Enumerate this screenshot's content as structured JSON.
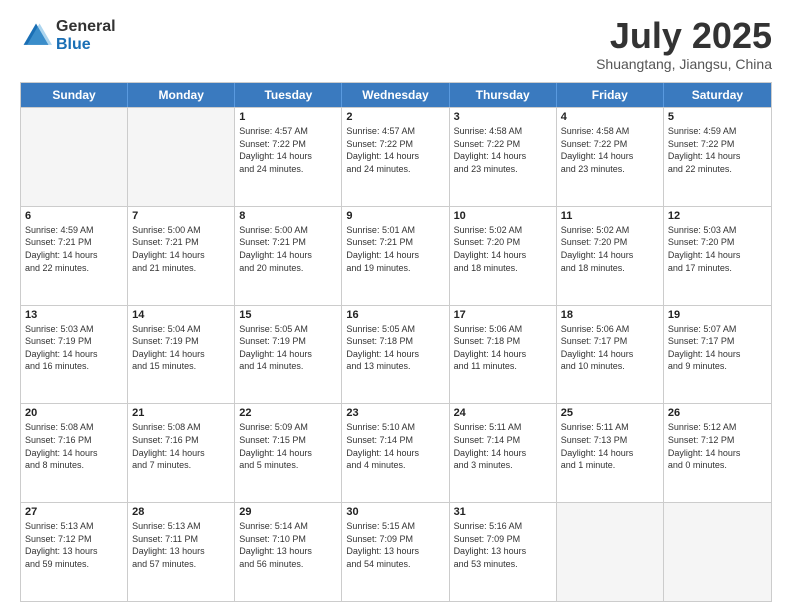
{
  "logo": {
    "general": "General",
    "blue": "Blue"
  },
  "title": "July 2025",
  "subtitle": "Shuangtang, Jiangsu, China",
  "days_of_week": [
    "Sunday",
    "Monday",
    "Tuesday",
    "Wednesday",
    "Thursday",
    "Friday",
    "Saturday"
  ],
  "weeks": [
    [
      {
        "day": "",
        "empty": true
      },
      {
        "day": "",
        "empty": true
      },
      {
        "day": "1",
        "lines": [
          "Sunrise: 4:57 AM",
          "Sunset: 7:22 PM",
          "Daylight: 14 hours",
          "and 24 minutes."
        ]
      },
      {
        "day": "2",
        "lines": [
          "Sunrise: 4:57 AM",
          "Sunset: 7:22 PM",
          "Daylight: 14 hours",
          "and 24 minutes."
        ]
      },
      {
        "day": "3",
        "lines": [
          "Sunrise: 4:58 AM",
          "Sunset: 7:22 PM",
          "Daylight: 14 hours",
          "and 23 minutes."
        ]
      },
      {
        "day": "4",
        "lines": [
          "Sunrise: 4:58 AM",
          "Sunset: 7:22 PM",
          "Daylight: 14 hours",
          "and 23 minutes."
        ]
      },
      {
        "day": "5",
        "lines": [
          "Sunrise: 4:59 AM",
          "Sunset: 7:22 PM",
          "Daylight: 14 hours",
          "and 22 minutes."
        ]
      }
    ],
    [
      {
        "day": "6",
        "lines": [
          "Sunrise: 4:59 AM",
          "Sunset: 7:21 PM",
          "Daylight: 14 hours",
          "and 22 minutes."
        ]
      },
      {
        "day": "7",
        "lines": [
          "Sunrise: 5:00 AM",
          "Sunset: 7:21 PM",
          "Daylight: 14 hours",
          "and 21 minutes."
        ]
      },
      {
        "day": "8",
        "lines": [
          "Sunrise: 5:00 AM",
          "Sunset: 7:21 PM",
          "Daylight: 14 hours",
          "and 20 minutes."
        ]
      },
      {
        "day": "9",
        "lines": [
          "Sunrise: 5:01 AM",
          "Sunset: 7:21 PM",
          "Daylight: 14 hours",
          "and 19 minutes."
        ]
      },
      {
        "day": "10",
        "lines": [
          "Sunrise: 5:02 AM",
          "Sunset: 7:20 PM",
          "Daylight: 14 hours",
          "and 18 minutes."
        ]
      },
      {
        "day": "11",
        "lines": [
          "Sunrise: 5:02 AM",
          "Sunset: 7:20 PM",
          "Daylight: 14 hours",
          "and 18 minutes."
        ]
      },
      {
        "day": "12",
        "lines": [
          "Sunrise: 5:03 AM",
          "Sunset: 7:20 PM",
          "Daylight: 14 hours",
          "and 17 minutes."
        ]
      }
    ],
    [
      {
        "day": "13",
        "lines": [
          "Sunrise: 5:03 AM",
          "Sunset: 7:19 PM",
          "Daylight: 14 hours",
          "and 16 minutes."
        ]
      },
      {
        "day": "14",
        "lines": [
          "Sunrise: 5:04 AM",
          "Sunset: 7:19 PM",
          "Daylight: 14 hours",
          "and 15 minutes."
        ]
      },
      {
        "day": "15",
        "lines": [
          "Sunrise: 5:05 AM",
          "Sunset: 7:19 PM",
          "Daylight: 14 hours",
          "and 14 minutes."
        ]
      },
      {
        "day": "16",
        "lines": [
          "Sunrise: 5:05 AM",
          "Sunset: 7:18 PM",
          "Daylight: 14 hours",
          "and 13 minutes."
        ]
      },
      {
        "day": "17",
        "lines": [
          "Sunrise: 5:06 AM",
          "Sunset: 7:18 PM",
          "Daylight: 14 hours",
          "and 11 minutes."
        ]
      },
      {
        "day": "18",
        "lines": [
          "Sunrise: 5:06 AM",
          "Sunset: 7:17 PM",
          "Daylight: 14 hours",
          "and 10 minutes."
        ]
      },
      {
        "day": "19",
        "lines": [
          "Sunrise: 5:07 AM",
          "Sunset: 7:17 PM",
          "Daylight: 14 hours",
          "and 9 minutes."
        ]
      }
    ],
    [
      {
        "day": "20",
        "lines": [
          "Sunrise: 5:08 AM",
          "Sunset: 7:16 PM",
          "Daylight: 14 hours",
          "and 8 minutes."
        ]
      },
      {
        "day": "21",
        "lines": [
          "Sunrise: 5:08 AM",
          "Sunset: 7:16 PM",
          "Daylight: 14 hours",
          "and 7 minutes."
        ]
      },
      {
        "day": "22",
        "lines": [
          "Sunrise: 5:09 AM",
          "Sunset: 7:15 PM",
          "Daylight: 14 hours",
          "and 5 minutes."
        ]
      },
      {
        "day": "23",
        "lines": [
          "Sunrise: 5:10 AM",
          "Sunset: 7:14 PM",
          "Daylight: 14 hours",
          "and 4 minutes."
        ]
      },
      {
        "day": "24",
        "lines": [
          "Sunrise: 5:11 AM",
          "Sunset: 7:14 PM",
          "Daylight: 14 hours",
          "and 3 minutes."
        ]
      },
      {
        "day": "25",
        "lines": [
          "Sunrise: 5:11 AM",
          "Sunset: 7:13 PM",
          "Daylight: 14 hours",
          "and 1 minute."
        ]
      },
      {
        "day": "26",
        "lines": [
          "Sunrise: 5:12 AM",
          "Sunset: 7:12 PM",
          "Daylight: 14 hours",
          "and 0 minutes."
        ]
      }
    ],
    [
      {
        "day": "27",
        "lines": [
          "Sunrise: 5:13 AM",
          "Sunset: 7:12 PM",
          "Daylight: 13 hours",
          "and 59 minutes."
        ]
      },
      {
        "day": "28",
        "lines": [
          "Sunrise: 5:13 AM",
          "Sunset: 7:11 PM",
          "Daylight: 13 hours",
          "and 57 minutes."
        ]
      },
      {
        "day": "29",
        "lines": [
          "Sunrise: 5:14 AM",
          "Sunset: 7:10 PM",
          "Daylight: 13 hours",
          "and 56 minutes."
        ]
      },
      {
        "day": "30",
        "lines": [
          "Sunrise: 5:15 AM",
          "Sunset: 7:09 PM",
          "Daylight: 13 hours",
          "and 54 minutes."
        ]
      },
      {
        "day": "31",
        "lines": [
          "Sunrise: 5:16 AM",
          "Sunset: 7:09 PM",
          "Daylight: 13 hours",
          "and 53 minutes."
        ]
      },
      {
        "day": "",
        "empty": true
      },
      {
        "day": "",
        "empty": true
      }
    ]
  ]
}
